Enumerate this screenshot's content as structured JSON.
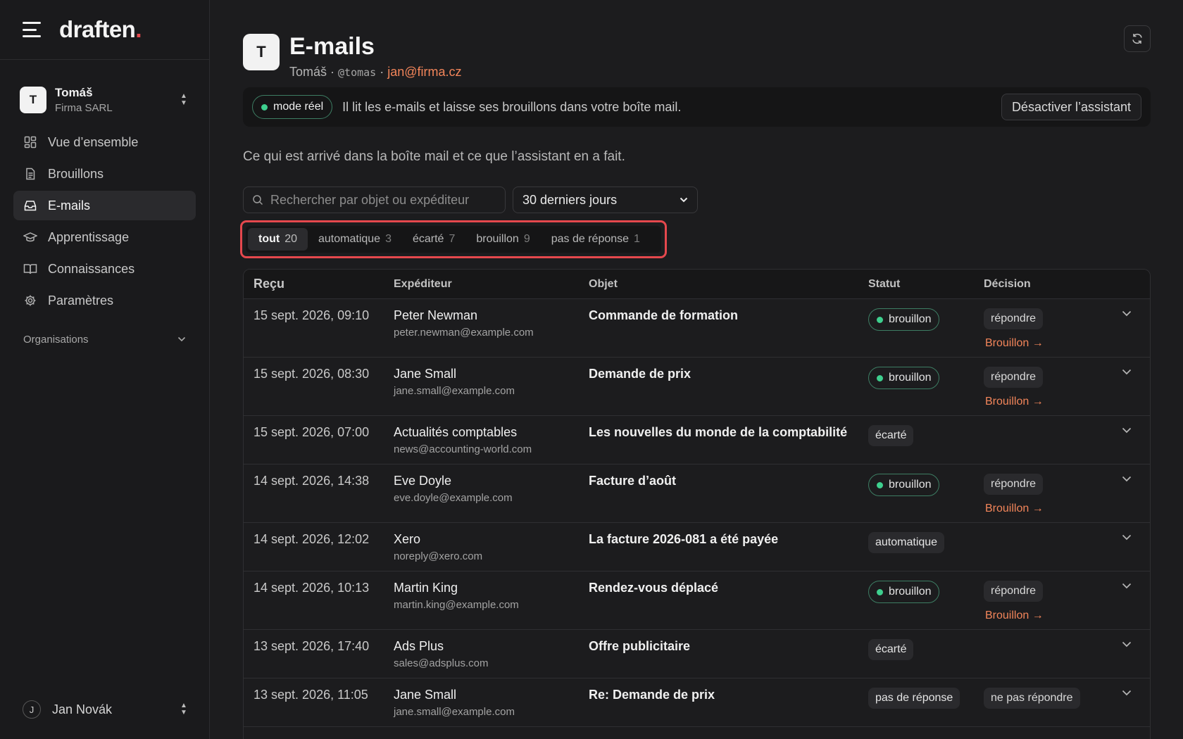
{
  "brand": {
    "name": "draften",
    "dot": "."
  },
  "org": {
    "avatar": "T",
    "name": "Tomáš",
    "company": "Firma SARL"
  },
  "nav": [
    {
      "label": "Vue d’ensemble",
      "icon": "grid-icon"
    },
    {
      "label": "Brouillons",
      "icon": "document-icon"
    },
    {
      "label": "E-mails",
      "icon": "inbox-icon",
      "active": true
    },
    {
      "label": "Apprentissage",
      "icon": "graduation-cap-icon"
    },
    {
      "label": "Connaissances",
      "icon": "book-icon"
    },
    {
      "label": "Paramètres",
      "icon": "gear-icon"
    }
  ],
  "organisations_label": "Organisations",
  "user": {
    "avatar": "J",
    "name": "Jan Novák"
  },
  "header": {
    "avatar": "T",
    "title": "E-mails",
    "name": "Tomáš",
    "sep": " · ",
    "handle": "@tomas",
    "email": "jan@firma.cz"
  },
  "banner": {
    "mode": "mode réel",
    "text": "Il lit les e-mails et laisse ses brouillons dans votre boîte mail.",
    "button": "Désactiver l’assistant"
  },
  "intro": "Ce qui est arrivé dans la boîte mail et ce que l’assistant en a fait.",
  "search": {
    "placeholder": "Rechercher par objet ou expéditeur"
  },
  "period": {
    "value": "30 derniers jours"
  },
  "filters": [
    {
      "label": "tout",
      "count": "20",
      "active": true
    },
    {
      "label": "automatique",
      "count": "3"
    },
    {
      "label": "écarté",
      "count": "7"
    },
    {
      "label": "brouillon",
      "count": "9"
    },
    {
      "label": "pas de réponse",
      "count": "1"
    }
  ],
  "table": {
    "columns": [
      "Reçu",
      "Expéditeur",
      "Objet",
      "Statut",
      "Décision"
    ],
    "rows": [
      {
        "received": "15 sept. 2026, 09:10",
        "sender": "Peter Newman",
        "email": "peter.newman@example.com",
        "subject": "Commande de formation",
        "status": "brouillon",
        "decision": "répondre",
        "link": "Brouillon →"
      },
      {
        "received": "15 sept. 2026, 08:30",
        "sender": "Jane Small",
        "email": "jane.small@example.com",
        "subject": "Demande de prix",
        "status": "brouillon",
        "decision": "répondre",
        "link": "Brouillon →"
      },
      {
        "received": "15 sept. 2026, 07:00",
        "sender": "Actualités comptables",
        "email": "news@accounting-world.com",
        "subject": "Les nouvelles du monde de la comptabilité",
        "status": "écarté",
        "decision": "",
        "link": ""
      },
      {
        "received": "14 sept. 2026, 14:38",
        "sender": "Eve Doyle",
        "email": "eve.doyle@example.com",
        "subject": "Facture d’août",
        "status": "brouillon",
        "decision": "répondre",
        "link": "Brouillon →"
      },
      {
        "received": "14 sept. 2026, 12:02",
        "sender": "Xero",
        "email": "noreply@xero.com",
        "subject": "La facture 2026-081 a été payée",
        "status": "automatique",
        "decision": "",
        "link": ""
      },
      {
        "received": "14 sept. 2026, 10:13",
        "sender": "Martin King",
        "email": "martin.king@example.com",
        "subject": "Rendez-vous déplacé",
        "status": "brouillon",
        "decision": "répondre",
        "link": "Brouillon →"
      },
      {
        "received": "13 sept. 2026, 17:40",
        "sender": "Ads Plus",
        "email": "sales@adsplus.com",
        "subject": "Offre publicitaire",
        "status": "écarté",
        "decision": "",
        "link": ""
      },
      {
        "received": "13 sept. 2026, 11:05",
        "sender": "Jane Small",
        "email": "jane.small@example.com",
        "subject": "Re: Demande de prix",
        "status": "pas de réponse",
        "decision": "ne pas répondre",
        "link": ""
      }
    ]
  },
  "colors": {
    "accent": "#f2855a",
    "highlight": "#e5484d",
    "green": "#3ecf8e"
  }
}
